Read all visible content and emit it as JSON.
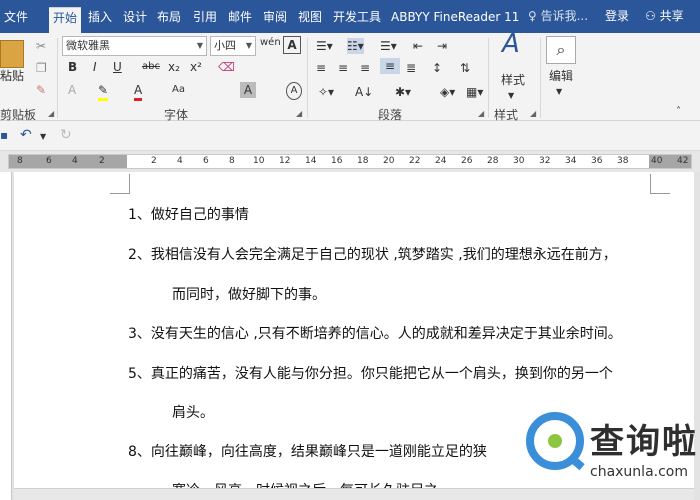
{
  "tabs": [
    "文件",
    "开始",
    "插入",
    "设计",
    "布局",
    "引用",
    "邮件",
    "审阅",
    "视图",
    "开发工具",
    "ABBYY FineReader 11"
  ],
  "tell_me": "告诉我...",
  "login": "登录",
  "share": "共享",
  "clipboard": {
    "paste_label": "粘贴",
    "group_label": "剪贴板"
  },
  "font": {
    "name": "微软雅黑",
    "size": "小四",
    "group_label": "字体",
    "wen_icon": "wén",
    "buttons": [
      "B",
      "I",
      "U",
      "abc",
      "x₂",
      "x²",
      "A",
      "A",
      "Aa",
      "A",
      "A"
    ]
  },
  "paragraph": {
    "group_label": "段落"
  },
  "styles": {
    "styles_label": "样式",
    "group_label": "样式"
  },
  "editing": {
    "label": "编辑"
  },
  "ruler": {
    "numbers": [
      "8",
      "6",
      "4",
      "2",
      "2",
      "4",
      "6",
      "8",
      "10",
      "12",
      "14",
      "16",
      "18",
      "20",
      "22",
      "24",
      "26",
      "28",
      "30",
      "32",
      "34",
      "36",
      "38",
      "40",
      "42"
    ]
  },
  "document": {
    "lines": [
      "1、做好自己的事情",
      "2、我相信没有人会完全满足于自己的现状 ,筑梦踏实 ,我们的理想永远在前方，",
      "而同时，做好脚下的事。",
      "3、没有天生的信心 ,只有不断培养的信心。人的成就和差异决定于其业余时间。",
      "5、真正的痛苦，没有人能与你分担。你只能把它从一个肩头，换到你的另一个",
      "肩头。",
      "8、向往巅峰，向往高度，结果巅峰只是一道刚能立足的狭",
      "寒冷，风高，时候视之后，每可长久驻足之"
    ]
  },
  "watermark": {
    "name": "查询啦",
    "url": "chaxunla.com"
  },
  "colors": {
    "accent": "#2b579a",
    "ribbon": "#f3f3f3",
    "logo_blue": "#3b8fd8",
    "logo_green": "#8cc63e"
  }
}
